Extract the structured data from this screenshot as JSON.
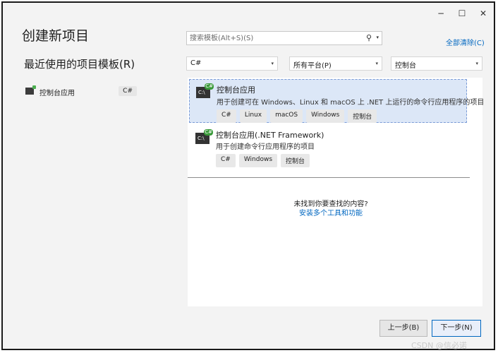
{
  "window_controls": {
    "minimize": "−",
    "maximize": "☐",
    "close": "✕"
  },
  "title": "创建新项目",
  "recent": {
    "heading": "最近使用的项目模板(R)",
    "items": [
      {
        "label": "控制台应用",
        "lang": "C#"
      }
    ]
  },
  "search": {
    "placeholder": "搜索模板(Alt+S)(S)",
    "icon": "search-icon"
  },
  "clear_all": "全部清除(C)",
  "filters": {
    "language": "C#",
    "platform": "所有平台(P)",
    "project_type": "控制台"
  },
  "templates": [
    {
      "icon_text": "C:\\",
      "name": "控制台应用",
      "description": "用于创建可在 Windows、Linux 和 macOS 上 .NET 上运行的命令行应用程序的项目",
      "tags": [
        "C#",
        "Linux",
        "macOS",
        "Windows",
        "控制台"
      ],
      "selected": true
    },
    {
      "icon_text": "C:\\",
      "name": "控制台应用(.NET Framework)",
      "description": "用于创建命令行应用程序的项目",
      "tags": [
        "C#",
        "Windows",
        "控制台"
      ],
      "selected": false
    }
  ],
  "not_found": {
    "text": "未找到你要查找的内容?",
    "link": "安装多个工具和功能"
  },
  "buttons": {
    "back": "上一步(B)",
    "next": "下一步(N)"
  },
  "watermark": "CSDN @信必诺",
  "colors": {
    "accent": "#0067c0",
    "selected_bg": "#dce7f7",
    "background": "#f3f3f3"
  }
}
